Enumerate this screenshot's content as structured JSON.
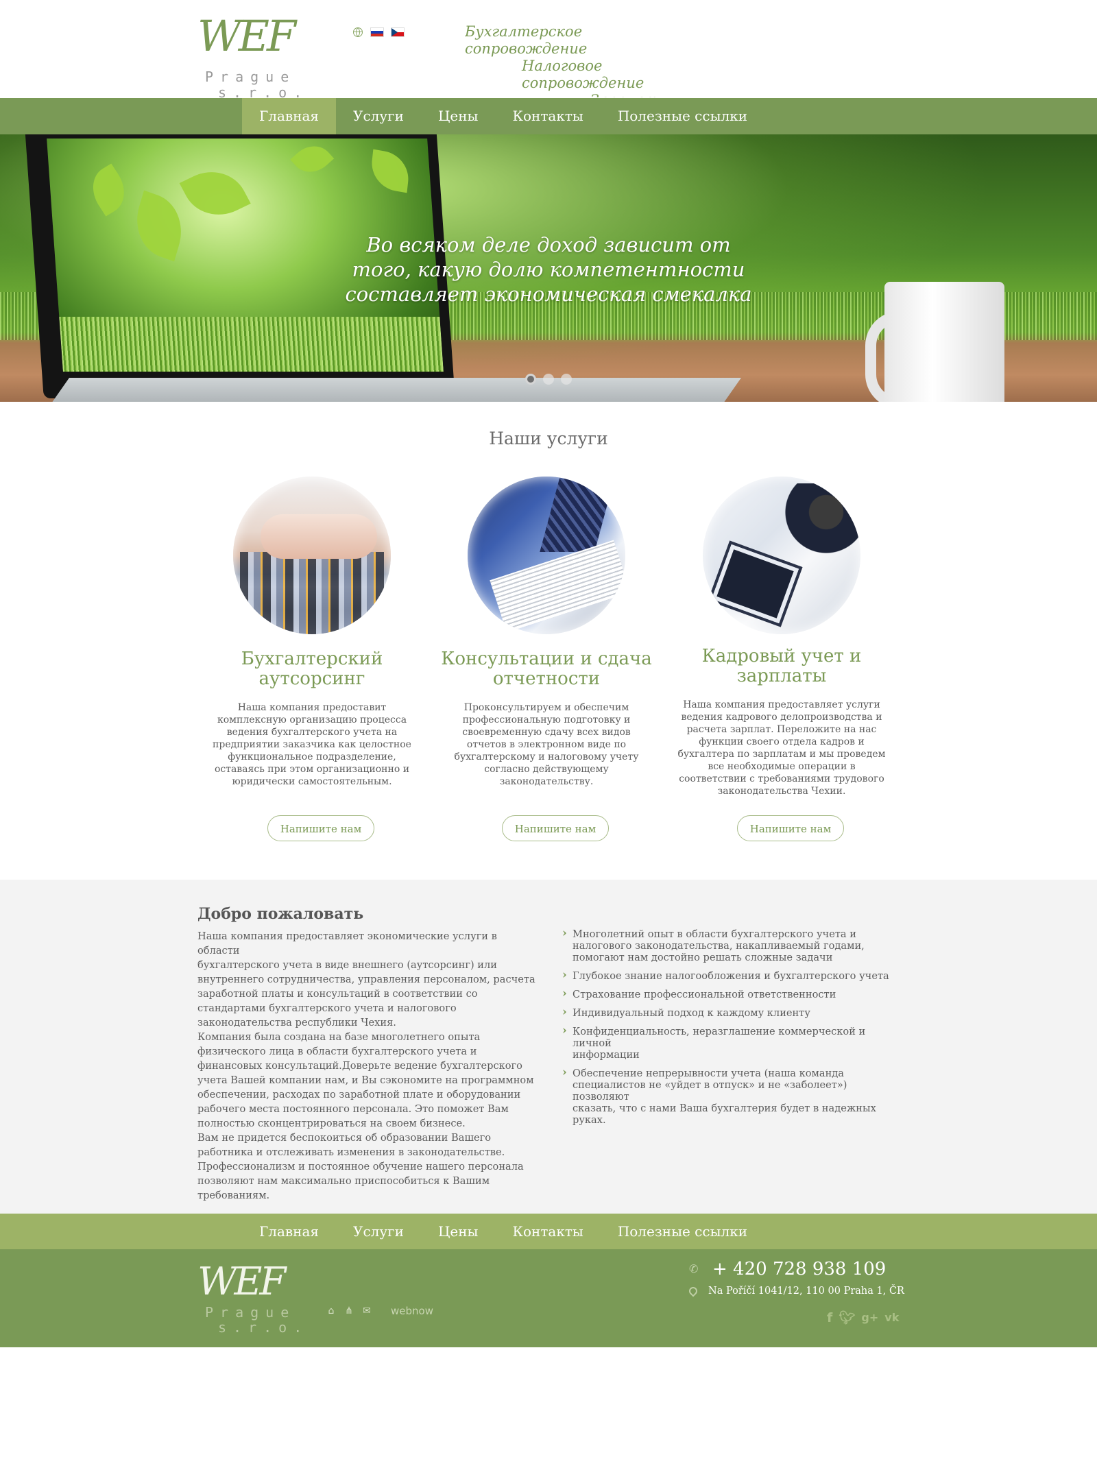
{
  "header": {
    "logo": {
      "mark": "WEF",
      "sub_line1": "Prague",
      "sub_line2": "s.r.o."
    },
    "languages": [
      {
        "code": "ru",
        "icon": "flag-russia-icon"
      },
      {
        "code": "cz",
        "icon": "flag-czech-icon"
      }
    ],
    "ticker": [
      "Бухгалтерское",
      "сопровождение",
      "Налоговое",
      "сопровождение",
      "Зарплаты"
    ]
  },
  "nav": {
    "items": [
      "Главная",
      "Услуги",
      "Цены",
      "Контакты",
      "Полезные ссылки"
    ],
    "active_index": 0
  },
  "hero": {
    "quote_lines": [
      "Во всяком деле доход зависит от",
      "того, какую долю компетентности",
      "составляет экономическая смекалка"
    ],
    "slides_total": 3,
    "active_slide": 1
  },
  "services": {
    "title": "Наши услуги",
    "items": [
      {
        "title_lines": [
          "Бухгалтерский",
          "аутсорсинг"
        ],
        "desc_lines": [
          "Наша компания предоставит",
          "комплексную организацию процесса",
          "ведения бухгалтерского учета на",
          "предприятии заказчика как целостное",
          "функциональное подразделение,",
          "оставаясь при этом организационно и",
          "юридически самостоятельным."
        ],
        "button": "Напишите нам"
      },
      {
        "title_lines": [
          "Консультации и сдача",
          "отчетности"
        ],
        "desc_lines": [
          "Проконсультируем и обеспечим",
          "профессиональную подготовку и",
          "своевременную сдачу всех видов",
          "отчетов в электронном виде по",
          "бухгалтерскому и налоговому учету",
          "согласно действующему",
          "законодательству."
        ],
        "button": "Напишите нам"
      },
      {
        "title_lines": [
          "Кадровый учет и",
          "зарплаты"
        ],
        "desc_lines": [
          "Наша компания предоставляет услуги",
          "ведения кадрового делопроизводства и",
          "расчета зарплат. Переложите на нас",
          "функции своего отдела кадров и",
          "бухгалтера по зарплатам и мы проведем",
          "все необходимые операции в",
          "соответствии с требованиями трудового",
          "законодательства Чехии."
        ],
        "button": "Напишите нам"
      }
    ]
  },
  "welcome": {
    "title": "Добро пожаловать",
    "text_lines": [
      "Наша компания предоставляет экономические услуги в области",
      "бухгалтерского учета в виде внешнего (аутсорсинг) или",
      "внутреннего сотрудничества, управления персоналом, расчета",
      "заработной платы и консультаций в соответствии со",
      "стандартами бухгалтерского учета и налогового",
      "законодательства республики Чехия.",
      "Компания была создана на базе многолетнего опыта",
      "физического лица в области бухгалтерского учета и",
      "финансовых консультаций.Доверьте ведение бухгалтерского",
      "учета Вашей компании нам, и Вы сэкономите на программном",
      "обеспечении, расходах по заработной плате и оборудовании",
      "рабочего места постоянного персонала. Это поможет Вам",
      "полностью сконцентрироваться на своем бизнесе.",
      "Вам не придется беспокоиться об образовании Вашего",
      "работника и отслеживать изменения в законодательстве.",
      "Профессионализм и постоянное обучение нашего персонала",
      "позволяют нам максимально приспособиться к Вашим",
      "требованиям."
    ],
    "features": [
      [
        "Многолетний опыт в области бухгалтерского учета и",
        "налогового законодательства, накапливаемый годами,",
        "помогают нам достойно решать сложные задачи"
      ],
      [
        "Глубокое знание налогообложения и бухгалтерского учета"
      ],
      [
        "Страхование профессиональной ответственности"
      ],
      [
        "Индивидуальный подход к каждому клиенту"
      ],
      [
        "Конфиденциальность, неразглашение коммерческой и личной",
        "информации"
      ],
      [
        "Обеспечение непрерывности учета (наша команда",
        "специалистов не «уйдет в отпуск» и не «заболеет») позволяют",
        "сказать, что с нами Ваша бухгалтерия будет в надежных",
        "руках."
      ]
    ]
  },
  "footer": {
    "nav": [
      "Главная",
      "Услуги",
      "Цены",
      "Контакты",
      "Полезные ссылки"
    ],
    "logo": {
      "mark": "WEF",
      "sub_line1": "Prague",
      "sub_line2": "s.r.o."
    },
    "icons": [
      "home-icon",
      "sitemap-icon",
      "mail-icon"
    ],
    "developer": "webnow",
    "phone": "+ 420 728 938 109",
    "address": "Na Poříčí 1041/12, 110 00 Praha 1, ČR",
    "social": [
      "facebook-icon",
      "twitter-icon",
      "google-plus-icon",
      "vk-icon"
    ]
  },
  "colors": {
    "accent_green": "#7a9a56",
    "light_green": "#9db366",
    "text": "#555555",
    "gray_bg": "#f3f3f3"
  }
}
